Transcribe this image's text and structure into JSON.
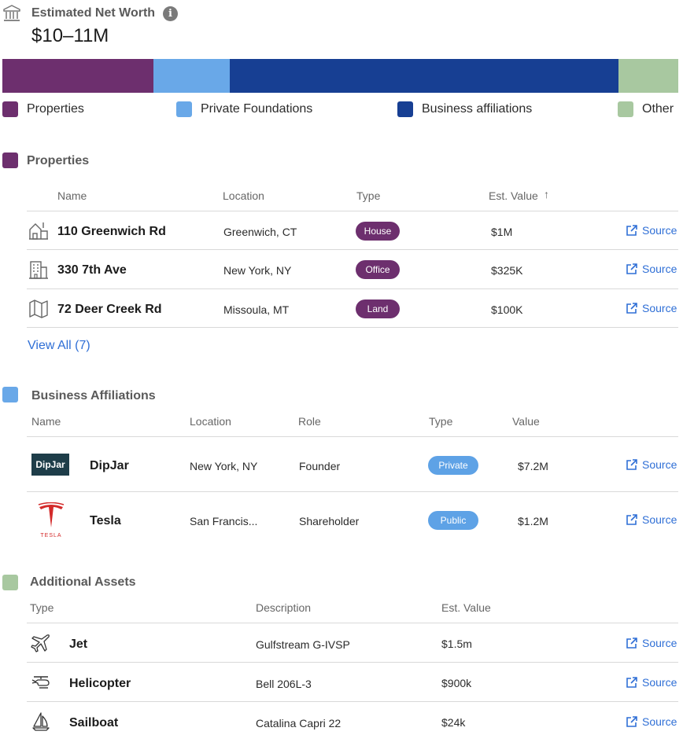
{
  "header": {
    "title": "Estimated Net Worth",
    "value": "$10–11M",
    "info_glyph": "i"
  },
  "breakdown": {
    "segments": [
      {
        "name": "Properties",
        "color": "#6d2f6e",
        "share": 0.223
      },
      {
        "name": "Private Foundations",
        "color": "#69a8e8",
        "share": 0.113
      },
      {
        "name": "Business affiliations",
        "color": "#173f93",
        "share": 0.576
      },
      {
        "name": "Other",
        "color": "#a8c8a0",
        "share": 0.088
      }
    ]
  },
  "properties": {
    "title": "Properties",
    "color": "#6d2f6e",
    "headers": {
      "name": "Name",
      "location": "Location",
      "type": "Type",
      "value": "Est. Value",
      "sort_glyph": "↑"
    },
    "rows": [
      {
        "icon": "house-icon",
        "name": "110 Greenwich Rd",
        "location": "Greenwich, CT",
        "type": "House",
        "value": "$1M",
        "source": "Source"
      },
      {
        "icon": "office-building-icon",
        "name": "330 7th Ave",
        "location": "New York, NY",
        "type": "Office",
        "value": "$325K",
        "source": "Source"
      },
      {
        "icon": "map-icon",
        "name": "72 Deer Creek Rd",
        "location": "Missoula, MT",
        "type": "Land",
        "value": "$100K",
        "source": "Source"
      }
    ],
    "view_all": "View All (7)"
  },
  "business": {
    "title": "Business Affiliations",
    "color": "#69a8e8",
    "headers": {
      "name": "Name",
      "location": "Location",
      "role": "Role",
      "type": "Type",
      "value": "Value"
    },
    "rows": [
      {
        "logo": "dipjar-logo",
        "logo_text": "DipJar",
        "name": "DipJar",
        "location": "New York, NY",
        "role": "Founder",
        "type": "Private",
        "value": "$7.2M",
        "source": "Source"
      },
      {
        "logo": "tesla-logo",
        "logo_text": "TESLA",
        "name": "Tesla",
        "location": "San Francis...",
        "role": "Shareholder",
        "type": "Public",
        "value": "$1.2M",
        "source": "Source"
      }
    ]
  },
  "assets": {
    "title": "Additional Assets",
    "color": "#a8c8a0",
    "headers": {
      "type": "Type",
      "description": "Description",
      "value": "Est. Value"
    },
    "rows": [
      {
        "icon": "airplane-icon",
        "type": "Jet",
        "description": "Gulfstream G-IVSP",
        "value": "$1.5m",
        "source": "Source"
      },
      {
        "icon": "helicopter-icon",
        "type": "Helicopter",
        "description": "Bell 206L-3",
        "value": "$900k",
        "source": "Source"
      },
      {
        "icon": "sailboat-icon",
        "type": "Sailboat",
        "description": "Catalina Capri 22",
        "value": "$24k",
        "source": "Source"
      }
    ]
  }
}
